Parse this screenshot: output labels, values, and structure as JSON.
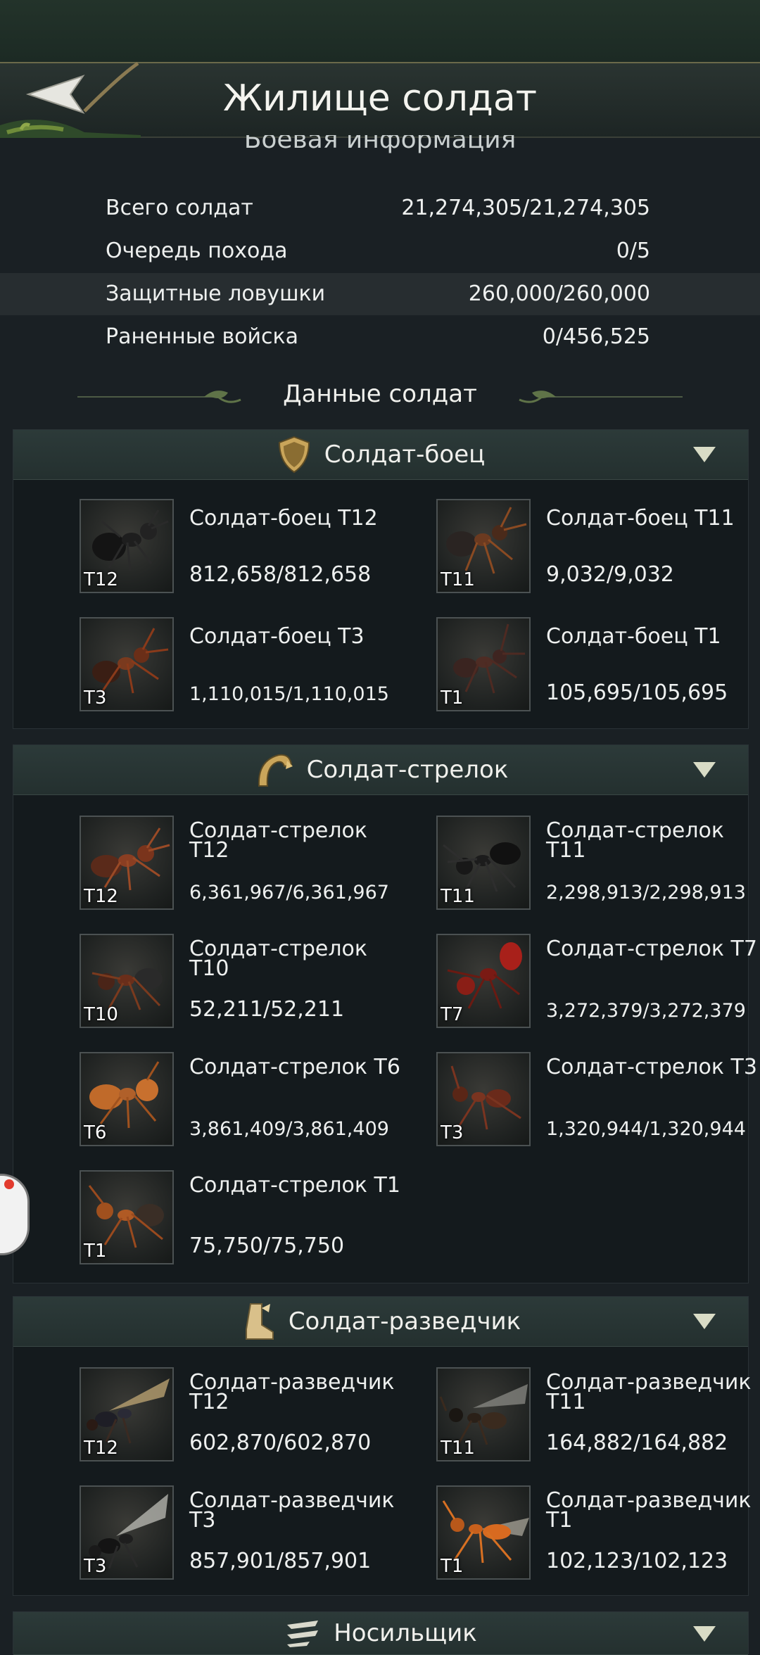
{
  "header": {
    "title": "Жилище солдат",
    "back_icon": "back-arrow-icon"
  },
  "combat_info": {
    "heading": "Боевая информация",
    "rows": [
      {
        "label": "Всего солдат",
        "value": "21,274,305/21,274,305"
      },
      {
        "label": "Очередь похода",
        "value": "0/5"
      },
      {
        "label": "Защитные ловушки",
        "value": "260,000/260,000"
      },
      {
        "label": "Раненные войска",
        "value": "0/456,525"
      }
    ]
  },
  "soldier_data_heading": "Данные солдат",
  "sections": [
    {
      "label": "Солдат-боец",
      "icon": "shield-icon",
      "units": [
        {
          "name": "Солдат-боец T12",
          "count": "812,658/812,658",
          "tier": "T12"
        },
        {
          "name": "Солдат-боец T11",
          "count": "9,032/9,032",
          "tier": "T11"
        },
        {
          "name": "Солдат-боец T3",
          "count": "1,110,015/1,110,015",
          "tier": "T3"
        },
        {
          "name": "Солдат-боец T1",
          "count": "105,695/105,695",
          "tier": "T1"
        }
      ]
    },
    {
      "label": "Солдат-стрелок",
      "icon": "bow-icon",
      "units": [
        {
          "name": "Солдат-стрелок T12",
          "count": "6,361,967/6,361,967",
          "tier": "T12"
        },
        {
          "name": "Солдат-стрелок T11",
          "count": "2,298,913/2,298,913",
          "tier": "T11"
        },
        {
          "name": "Солдат-стрелок T10",
          "count": "52,211/52,211",
          "tier": "T10"
        },
        {
          "name": "Солдат-стрелок T7",
          "count": "3,272,379/3,272,379",
          "tier": "T7"
        },
        {
          "name": "Солдат-стрелок T6",
          "count": "3,861,409/3,861,409",
          "tier": "T6"
        },
        {
          "name": "Солдат-стрелок T3",
          "count": "1,320,944/1,320,944",
          "tier": "T3"
        },
        {
          "name": "Солдат-стрелок T1",
          "count": "75,750/75,750",
          "tier": "T1"
        }
      ]
    },
    {
      "label": "Солдат-разведчик",
      "icon": "boot-icon",
      "units": [
        {
          "name": "Солдат-разведчик T12",
          "count": "602,870/602,870",
          "tier": "T12"
        },
        {
          "name": "Солдат-разведчик T11",
          "count": "164,882/164,882",
          "tier": "T11"
        },
        {
          "name": "Солдат-разведчик T3",
          "count": "857,901/857,901",
          "tier": "T3"
        },
        {
          "name": "Солдат-разведчик T1",
          "count": "102,123/102,123",
          "tier": "T1"
        }
      ]
    },
    {
      "label": "Носильщик",
      "icon": "carrier-icon"
    }
  ],
  "colors": {
    "background": "#1a2024",
    "section_bar": "#2c3a39",
    "panel": "#141a1d",
    "text": "#eef0ef",
    "accent_gold": "#c9a55a"
  }
}
